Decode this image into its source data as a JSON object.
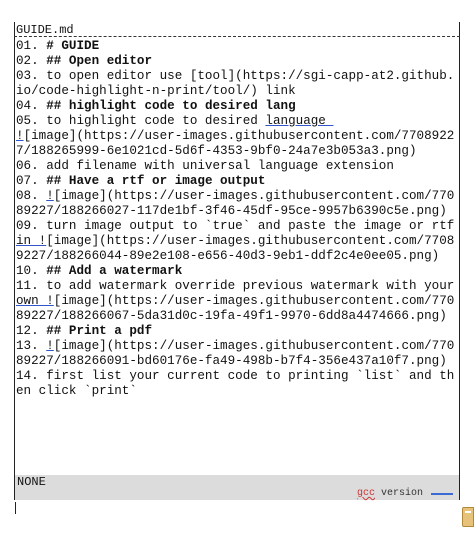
{
  "file_title": "GUIDE.md",
  "lines": [
    [
      {
        "t": "01. "
      },
      {
        "t": "# GUIDE",
        "b": true
      }
    ],
    [
      {
        "t": "02. "
      },
      {
        "t": "## Open editor",
        "b": true
      }
    ],
    [
      {
        "t": "03. to open editor use [tool](https://sgi-capp-at2.github.io/code-highlight-n-print/tool/) link"
      }
    ],
    [
      {
        "t": "04. "
      },
      {
        "t": "## highlight code to desired lang",
        "b": true
      }
    ],
    [
      {
        "t": "05. to highlight code to desired "
      },
      {
        "t": "language ",
        "u": true
      }
    ],
    [
      {
        "t": "!",
        "u": true
      },
      {
        "t": "[image](https://user-images.githubusercontent.com/77089227/188265999-6e1021cd-5d6f-4353-9bf0-24a7e3b053a3.png)"
      }
    ],
    [
      {
        "t": "06. add filename with universal language extension"
      }
    ],
    [
      {
        "t": "07. "
      },
      {
        "t": "## Have a rtf or image output",
        "b": true
      }
    ],
    [
      {
        "t": "08. "
      },
      {
        "t": "!",
        "u": true
      },
      {
        "t": "[image](https://user-images.githubusercontent.com/77089227/188266027-117de1bf-3f46-45df-95ce-9957b6390c5e.png)"
      }
    ],
    [
      {
        "t": "09. turn image output to `true` and paste the image or rtf "
      },
      {
        "t": "in !",
        "u": true
      },
      {
        "t": "[image](https://user-images.githubusercontent.com/77089227/188266044-89e2e108-e656-40d3-9eb1-ddf2c4e0ee05.png)"
      }
    ],
    [
      {
        "t": "10. "
      },
      {
        "t": "## Add a watermark",
        "b": true
      }
    ],
    [
      {
        "t": "11. to add watermark override previous watermark with your "
      },
      {
        "t": "own !",
        "u": true
      },
      {
        "t": "[image](https://user-images.githubusercontent.com/77089227/188266067-5da31d0c-19fa-49f1-9970-6dd8a4474666.png)"
      }
    ],
    [
      {
        "t": "12. "
      },
      {
        "t": "## Print a pdf",
        "b": true
      }
    ],
    [
      {
        "t": "13. "
      },
      {
        "t": "!",
        "u": true
      },
      {
        "t": "[image](https://user-images.githubusercontent.com/77089227/188266091-bd60176e-fa49-498b-b7f4-356e437a10f7.png)"
      }
    ],
    [
      {
        "t": "14. first list your current code to printing `list` and then click `print`"
      }
    ]
  ],
  "status": {
    "left": "NONE",
    "right_gcc": "gcc",
    "right_text": " version "
  }
}
